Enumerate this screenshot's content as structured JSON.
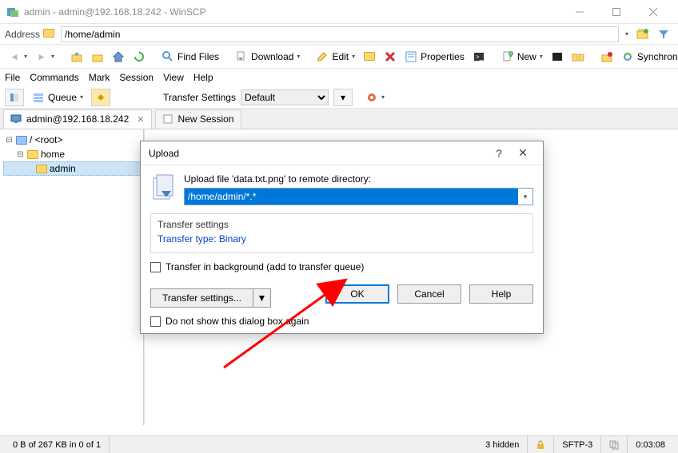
{
  "window": {
    "title": "admin - admin@192.168.18.242 - WinSCP"
  },
  "addressbar": {
    "label": "Address",
    "value": "/home/admin"
  },
  "toolbar": {
    "find_files": "Find Files",
    "download": "Download",
    "edit": "Edit",
    "properties": "Properties",
    "new": "New",
    "synchronize": "Synchronize"
  },
  "menu": {
    "file": "File",
    "commands": "Commands",
    "mark": "Mark",
    "session": "Session",
    "view": "View",
    "help": "Help"
  },
  "queue": {
    "label": "Queue",
    "transfer_settings_label": "Transfer Settings",
    "transfer_settings_value": "Default"
  },
  "tabs": {
    "session": "admin@192.168.18.242",
    "new_session": "New Session"
  },
  "tree": {
    "root": "/ <root>",
    "home": "home",
    "admin": "admin"
  },
  "dialog": {
    "title": "Upload",
    "prompt": "Upload file 'data.txt.png' to remote directory:",
    "path": "/home/admin/*.*",
    "settings_header": "Transfer settings",
    "settings_value": "Transfer type: Binary",
    "bg_label": "Transfer in background (add to transfer queue)",
    "ts_btn": "Transfer settings...",
    "ok": "OK",
    "cancel": "Cancel",
    "help": "Help",
    "dont_show": "Do not show this dialog box again"
  },
  "status": {
    "selection": "0 B of 267 KB in 0 of 1",
    "hidden": "3 hidden",
    "protocol": "SFTP-3",
    "time": "0:03:08"
  }
}
